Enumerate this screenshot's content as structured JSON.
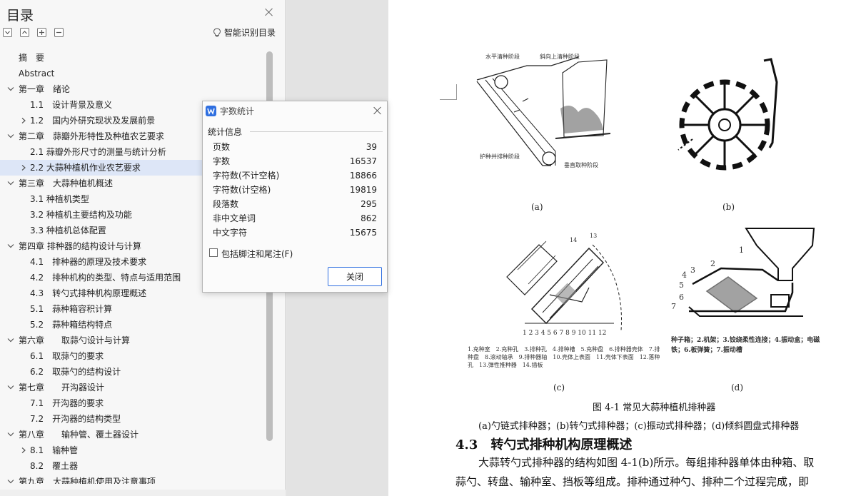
{
  "toc": {
    "title": "目录",
    "smart_label": "智能识别目录",
    "items": [
      {
        "label": "摘　要",
        "expand": "none",
        "selected": false
      },
      {
        "label": "Abstract",
        "expand": "none",
        "selected": false
      },
      {
        "label": "第一章　绪论",
        "expand": "open",
        "selected": false
      },
      {
        "label": "1.1　设计背景及意义",
        "expand": "none",
        "selected": false
      },
      {
        "label": "1.2　国内外研究现状及发展前景",
        "expand": "closed",
        "selected": false
      },
      {
        "label": "第二章　蒜瓣外形特性及种植农艺要求",
        "expand": "open",
        "selected": false
      },
      {
        "label": "2.1 蒜瓣外形尺寸的测量与统计分析",
        "expand": "none",
        "selected": false
      },
      {
        "label": "2.2 大蒜种植机作业农艺要求",
        "expand": "closed",
        "selected": true
      },
      {
        "label": "第三章　大蒜种植机概述",
        "expand": "open",
        "selected": false
      },
      {
        "label": "3.1 种植机类型",
        "expand": "none",
        "selected": false
      },
      {
        "label": "3.2 种植机主要结构及功能",
        "expand": "none",
        "selected": false
      },
      {
        "label": "3.3 种植机总体配置",
        "expand": "none",
        "selected": false
      },
      {
        "label": "第四章 排种器的结构设计与计算",
        "expand": "open",
        "selected": false
      },
      {
        "label": "4.1　排种器的原理及技术要求",
        "expand": "none",
        "selected": false
      },
      {
        "label": "4.2　排种机构的类型、特点与适用范围",
        "expand": "none",
        "selected": false
      },
      {
        "label": "4.3　转勺式排种机构原理概述",
        "expand": "none",
        "selected": false
      },
      {
        "label": "5.1　蒜种箱容积计算",
        "expand": "none",
        "selected": false
      },
      {
        "label": "5.2　蒜种箱结构特点",
        "expand": "none",
        "selected": false
      },
      {
        "label": "第六章　　取蒜勺设计与计算",
        "expand": "open",
        "selected": false
      },
      {
        "label": "6.1　取蒜勺的要求",
        "expand": "none",
        "selected": false
      },
      {
        "label": "6.2　取蒜勺的结构设计",
        "expand": "none",
        "selected": false
      },
      {
        "label": "第七章　　开沟器设计",
        "expand": "open",
        "selected": false
      },
      {
        "label": "7.1　开沟器的要求",
        "expand": "none",
        "selected": false
      },
      {
        "label": "7.2　开沟器的结构类型",
        "expand": "none",
        "selected": false
      },
      {
        "label": "第八章　　输种管、覆土器设计",
        "expand": "open",
        "selected": false
      },
      {
        "label": "8.1　输种管",
        "expand": "closed",
        "selected": false
      },
      {
        "label": "8.2　覆土器",
        "expand": "none",
        "selected": false
      },
      {
        "label": "第九章　大蒜种植机使用及注意事项",
        "expand": "open",
        "selected": false
      }
    ]
  },
  "dialog": {
    "title": "字数统计",
    "section": "统计信息",
    "stats": [
      {
        "label": "页数",
        "value": "39"
      },
      {
        "label": "字数",
        "value": "16537"
      },
      {
        "label": "字符数(不计空格)",
        "value": "18866"
      },
      {
        "label": "字符数(计空格)",
        "value": "19819"
      },
      {
        "label": "段落数",
        "value": "295"
      },
      {
        "label": "非中文单词",
        "value": "862"
      },
      {
        "label": "中文字符",
        "value": "15675"
      }
    ],
    "checkbox_label": "包括脚注和尾注(F)",
    "close_label": "关闭"
  },
  "document": {
    "fig_a": {
      "label": "(a)",
      "note1": "水平清种阶段",
      "note2": "斜向上清种阶段",
      "note3": "护种并排种阶段",
      "note4": "垂直取种阶段"
    },
    "fig_b": {
      "label": "(b)"
    },
    "fig_c": {
      "label": "(c)",
      "legend": "1.充种室　2.充种孔　3.排种孔　4.排种槽　5.充种盘　6.排种器壳体　7.排种盘　8.滚动轴承　9.排种器轴　10.壳体上表面　11.壳体下表面　12.落种孔　13.弹性推种器　14.插板",
      "numbers": "1 2 3 4 5 6 7 8 9 10 11 12",
      "num13": "13",
      "num14": "14"
    },
    "fig_d": {
      "label": "(d)",
      "legend": "种子箱；2.机架；3.铰绕柔性连接；4.振动盒；电磁铁；6.板弹簧；7.振动槽",
      "n1": "1",
      "n2": "2",
      "n3": "3",
      "n4": "4",
      "n5": "5",
      "n6": "6",
      "n7": "7"
    },
    "caption": "图 4-1 常见大蒜种植机排种器",
    "subcaption": "(a)勺链式排种器；(b)转勺式排种器；(c)振动式排种器；(d)倾斜圆盘式排种器",
    "heading": "4.3　转勺式排种机构原理概述",
    "para1": "大蒜转勺式排种器的结构如图 4-1(b)所示。每组排种器单体由种箱、取",
    "para2": "蒜勺、转盘、输种室、挡板等组成。排种通过种勺、排种二个过程完成，即"
  }
}
